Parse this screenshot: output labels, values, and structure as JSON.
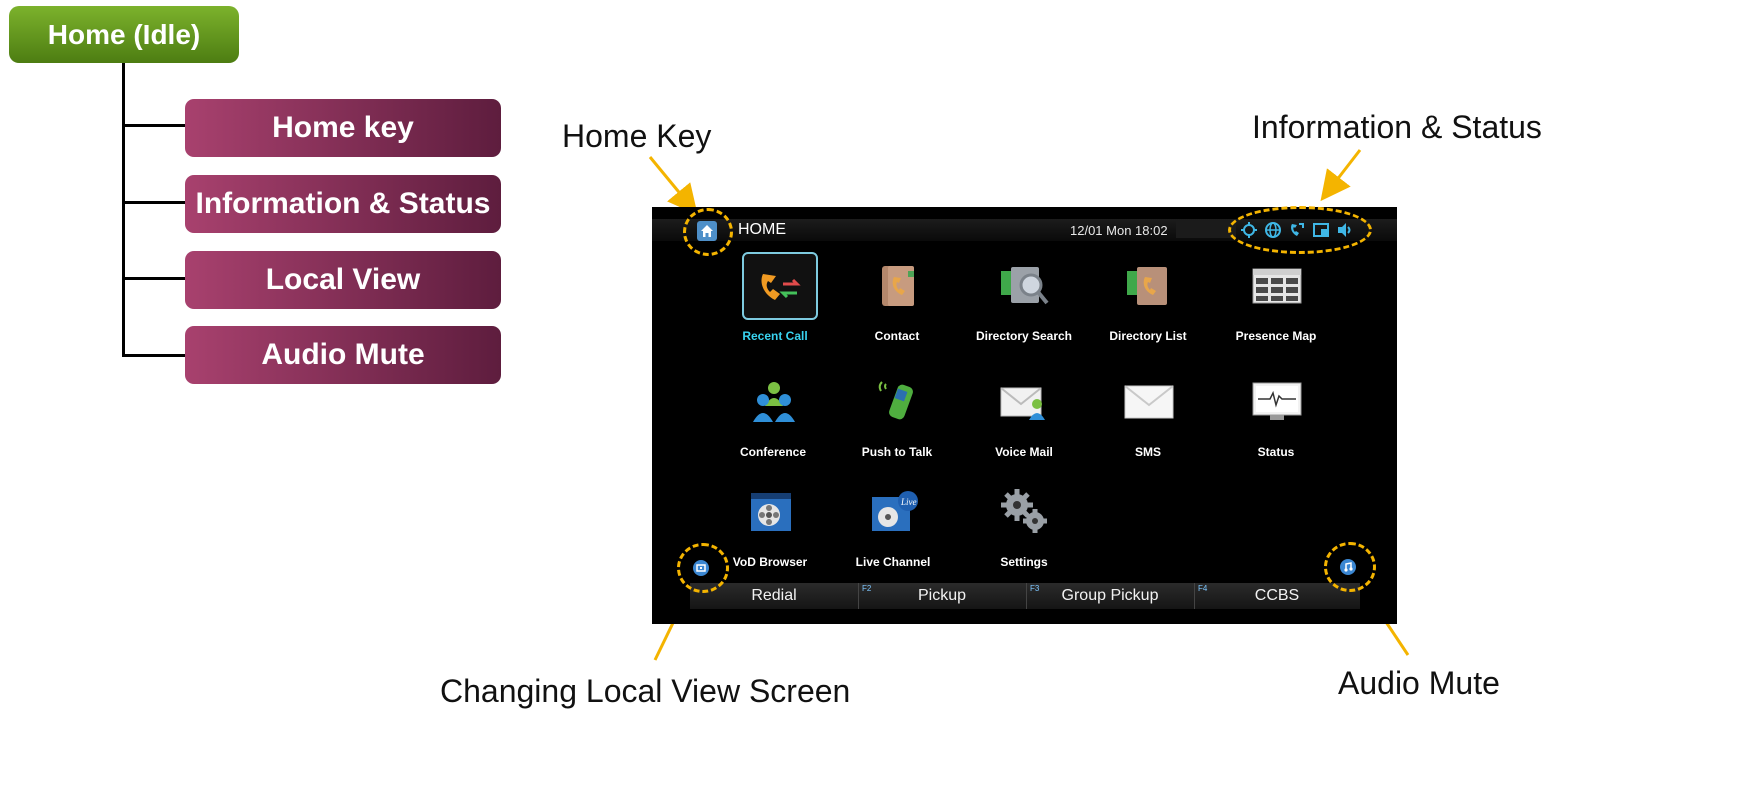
{
  "tree": {
    "root": "Home (Idle)",
    "children": [
      "Home key",
      "Information & Status",
      "Local View",
      "Audio Mute"
    ]
  },
  "callouts": {
    "home_key": "Home Key",
    "info_status": "Information & Status",
    "local_view": "Changing Local View Screen",
    "audio_mute": "Audio Mute"
  },
  "screen": {
    "title": "HOME",
    "datetime": "12/01 Mon 18:02",
    "status_icons": [
      "gear-icon",
      "globe-icon",
      "phone-forward-icon",
      "window-icon",
      "speaker-icon"
    ],
    "tiles": [
      {
        "label": "Recent Call",
        "icon": "recent-call-icon",
        "selected": true
      },
      {
        "label": "Contact",
        "icon": "contact-book-icon"
      },
      {
        "label": "Directory Search",
        "icon": "directory-search-icon"
      },
      {
        "label": "Directory List",
        "icon": "directory-list-icon"
      },
      {
        "label": "Presence Map",
        "icon": "presence-map-icon"
      },
      {
        "label": "Conference",
        "icon": "conference-icon"
      },
      {
        "label": "Push to Talk",
        "icon": "push-to-talk-icon"
      },
      {
        "label": "Voice Mail",
        "icon": "voice-mail-icon"
      },
      {
        "label": "SMS",
        "icon": "sms-envelope-icon"
      },
      {
        "label": "Status",
        "icon": "status-monitor-icon"
      },
      {
        "label": "VoD Browser",
        "icon": "vod-browser-icon"
      },
      {
        "label": "Live Channel",
        "icon": "live-channel-icon"
      },
      {
        "label": "Settings",
        "icon": "settings-gears-icon"
      }
    ],
    "softkeys": [
      {
        "fkey": "",
        "label": "Redial"
      },
      {
        "fkey": "F2",
        "label": "Pickup"
      },
      {
        "fkey": "F3",
        "label": "Group Pickup"
      },
      {
        "fkey": "F4",
        "label": "CCBS"
      }
    ]
  },
  "colors": {
    "root_green": "#5f9a1a",
    "child_purple": "#8a2f5c",
    "highlight_ring": "#f4b400",
    "selected_label": "#39d3f0"
  }
}
